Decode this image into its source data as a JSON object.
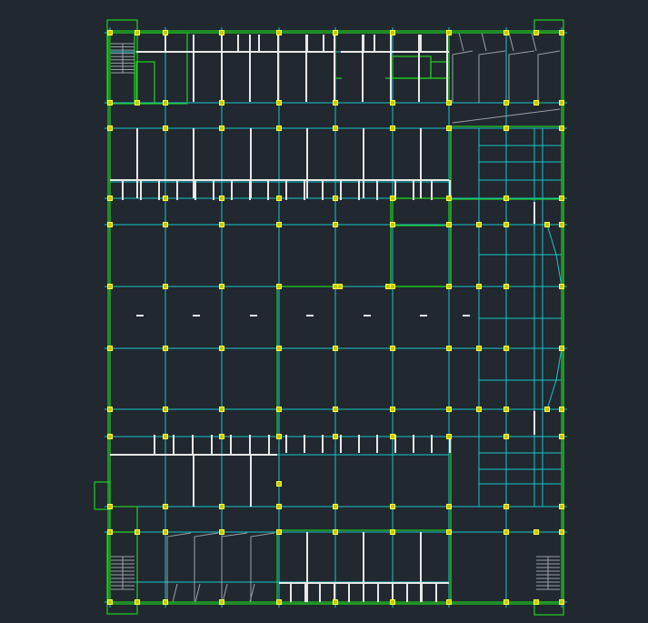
{
  "colors": {
    "background": "#212830",
    "grid_lines": "#17c6cc",
    "walls": "#1fd01f",
    "partitions": "#e8e8e8",
    "stairs": "#9aa0a6",
    "column_markers": "#ffff40"
  },
  "icons": [
    "stair-icon",
    "column-marker-icon"
  ]
}
